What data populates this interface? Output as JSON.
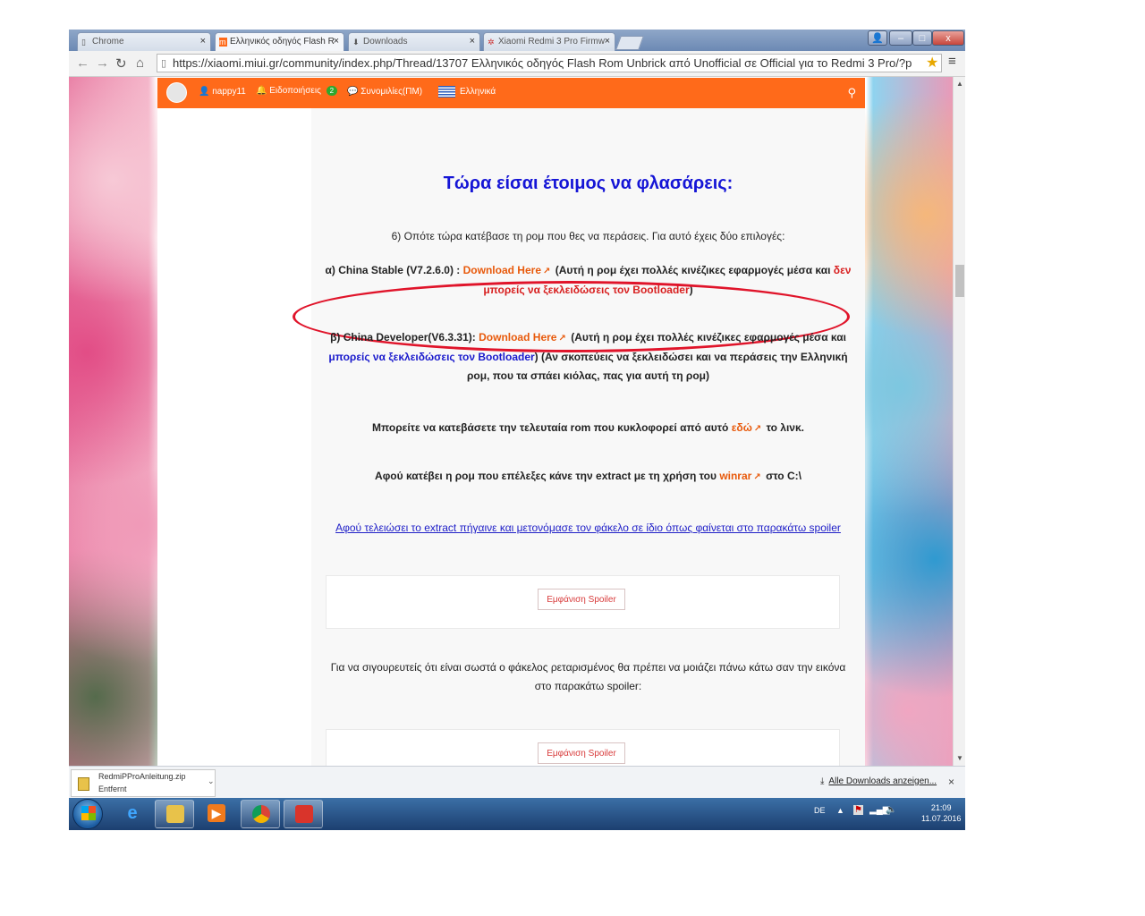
{
  "tabs": [
    {
      "label": "Chrome",
      "icon": "page-icon",
      "active": false
    },
    {
      "label": "Ελληνικός οδηγός Flash R",
      "icon": "miui-icon",
      "active": true
    },
    {
      "label": "Downloads",
      "icon": "download-icon",
      "active": false
    },
    {
      "label": "Xiaomi Redmi 3 Pro Firmw",
      "icon": "settings-icon",
      "active": false
    }
  ],
  "window_controls": {
    "minimize": "–",
    "maximize": "□",
    "close": "x"
  },
  "address": {
    "url": "https://xiaomi.miui.gr/community/index.php/Thread/13707 Ελληνικός οδηγός Flash Rom Unbrick από Unofficial σε Official για το Redmi 3 Pro/?p"
  },
  "site_nav": {
    "username": "nappy11",
    "notifications_label": "Ειδοποιήσεις",
    "notifications_count": "2",
    "conversations_label": "Συνομιλίες(ΠΜ)",
    "language_label": "Ελληνικά"
  },
  "article": {
    "heading": "Τώρα είσαι έτοιμος να φλασάρεις:",
    "p1": "6) Οπότε τώρα κατέβασε τη ρομ που θες να περάσεις. Για αυτό έχεις δύο επιλογές:",
    "opt_a": {
      "prefix": "α) China Stable (V7.2.6.0) :",
      "link": "Download Here",
      "mid": "(Αυτή η ρομ έχει πολλές κινέζικες εφαρμογές μέσα και",
      "warning": "δεν μπορείς να ξεκλειδώσεις τον Bootloader",
      "suffix": ")"
    },
    "opt_b": {
      "prefix": "β) China Developer(V6.3.31):",
      "link": "Download Here",
      "mid": "(Αυτή η ρομ έχει πολλές κινέζικες εφαρμογές μέσα και",
      "highlight": "μπορείς να ξεκλειδώσεις τον Bootloader",
      "suffix": ") (Αν σκοπεύεις να ξεκλειδώσει και να περάσεις την Ελληνική ρομ, που τα σπάει κιόλας, πας για αυτή τη ρομ)"
    },
    "p_latest": {
      "before": "Μπορείτε να κατεβάσετε την τελευταία rom που κυκλοφορεί από αυτό",
      "link": "εδώ",
      "after": "το λινκ."
    },
    "p_extract": {
      "before": "Αφού κατέβει η ρομ που επέλεξες κάνε την extract με τη χρήση του",
      "link": "winrar",
      "after": "στο C:\\"
    },
    "p_rename_link": "Αφού τελειώσει το extract πήγαινε και μετονόμασε τον φάκελο σε ίδιο όπως φαίνεται στο παρακάτω spoiler",
    "spoiler_label": "Εμφάνιση Spoiler",
    "p_verify": "Για να σιγουρευτείς ότι είναι σωστά ο φάκελος ρεταρισμένος θα πρέπει να μοιάζει πάνω κάτω σαν την εικόνα στο παρακάτω spoiler:",
    "spoiler_label_2": "Εμφάνιση Spoiler"
  },
  "download_shelf": {
    "file_name": "RedmiPProAnleitung.zip",
    "file_status": "Entfernt",
    "show_all": "Alle Downloads anzeigen...",
    "close": "×"
  },
  "taskbar": {
    "language": "DE",
    "time": "21:09",
    "date": "11.07.2016"
  },
  "colors": {
    "nav_orange": "#ff6a1a",
    "heading_blue": "#1515d6",
    "annotation_red": "#e0142a"
  }
}
